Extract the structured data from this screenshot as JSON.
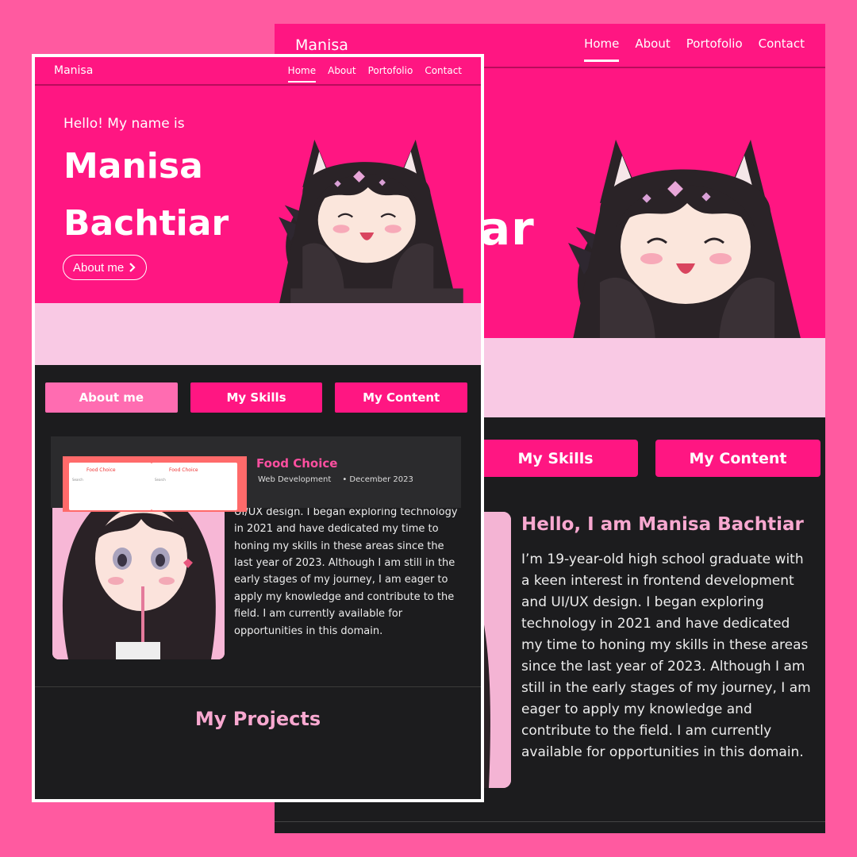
{
  "brand": "Manisa",
  "nav": {
    "home": "Home",
    "about": "About",
    "portfolio": "Portofolio",
    "contact": "Contact"
  },
  "hero": {
    "greeting": "Hello! My name is",
    "name": "Manisa Bachtiar",
    "button_label": "About me",
    "back_partial_text": "ar"
  },
  "tabs": {
    "about": "About me",
    "skills": "My Skills",
    "content": "My Content"
  },
  "about": {
    "title": "Hello, I am Manisa Bachtiar",
    "body": "I’m 19-year-old high school graduate with a keen interest in frontend development and UI/UX design. I began exploring technology in 2021 and have dedicated my time to honing my skills in these areas since the last year of 2023. Although I am still in the early stages of my journey, I am eager to apply my knowledge and contribute to the field. I am currently available for opportunities in this domain."
  },
  "projects": {
    "title": "My Projects",
    "items": [
      {
        "title": "Food Choice",
        "category": "Web Development",
        "date": "December 2023",
        "thumb_label": "Food Choice",
        "thumb_search": "Search"
      }
    ]
  },
  "icons": {
    "chevron": "chevron-right-icon",
    "menu": "menu-icon",
    "search": "search-icon"
  },
  "colors": {
    "page_bg": "#ff5aa0",
    "accent": "#ff1682",
    "light_pink": "#f9c9e4",
    "dark_bg": "#1c1c1e",
    "heading_pink": "#f8a8d0"
  }
}
